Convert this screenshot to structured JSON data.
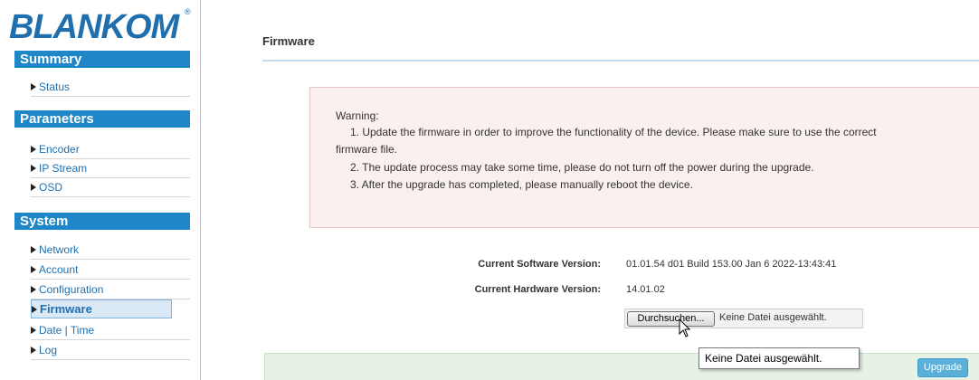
{
  "brand": {
    "logo_text": "BLANKOM",
    "registered_mark": "®",
    "color": "#1f6fae"
  },
  "sidebar": {
    "sections": [
      {
        "title": "Summary",
        "items": [
          {
            "label": "Status"
          }
        ]
      },
      {
        "title": "Parameters",
        "items": [
          {
            "label": "Encoder"
          },
          {
            "label": "IP Stream"
          },
          {
            "label": "OSD"
          }
        ]
      },
      {
        "title": "System",
        "items": [
          {
            "label": "Network"
          },
          {
            "label": "Account"
          },
          {
            "label": "Configuration"
          },
          {
            "label": "Firmware",
            "active": true
          },
          {
            "label": "Date | Time"
          },
          {
            "label": "Log"
          }
        ]
      }
    ]
  },
  "main": {
    "title": "Firmware",
    "warning": {
      "title": "Warning:",
      "line1a": "1. Update the firmware in order to improve the functionality of the device. Please make sure to use the correct",
      "line1b": "firmware file.",
      "line2": "2. The update process may take some time, please do not turn off the power during the upgrade.",
      "line3": "3. After the upgrade has completed, please manually reboot the device."
    },
    "software_label": "Current Software Version:",
    "software_value": "01.01.54 d01 Build 153.00 Jan 6 2022-13:43:41",
    "hardware_label": "Current Hardware Version:",
    "hardware_value": "14.01.02",
    "browse_label": "Durchsuchen...",
    "file_status": "Keine Datei ausgewählt.",
    "tooltip": "Keine Datei ausgewählt.",
    "upgrade_label": "Upgrade"
  },
  "colors": {
    "accent": "#1f87c8",
    "warning_bg": "#fbf0f0",
    "footer_bg": "#e6f2e6",
    "button": "#5bb0da"
  }
}
